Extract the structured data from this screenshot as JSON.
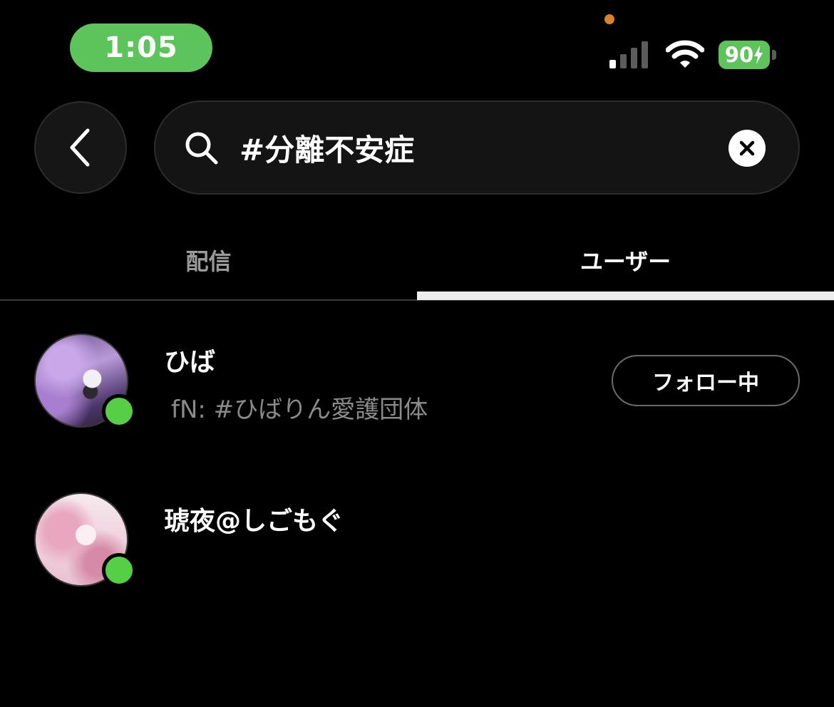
{
  "status_bar": {
    "time": "1:05",
    "battery": "90"
  },
  "search": {
    "query": "#分離不安症"
  },
  "tabs": [
    {
      "label": "配信",
      "selected": false
    },
    {
      "label": "ユーザー",
      "selected": true
    }
  ],
  "users": [
    {
      "name": "ひば",
      "bio": "fN: #ひばりん愛護団体",
      "online": true,
      "follow_label": "フォロー中"
    },
    {
      "name": "琥夜@しごもぐ",
      "bio": "",
      "online": true
    }
  ],
  "colors": {
    "accent_green": "#5cc45a",
    "online_green": "#54cf46",
    "background": "#000000"
  }
}
